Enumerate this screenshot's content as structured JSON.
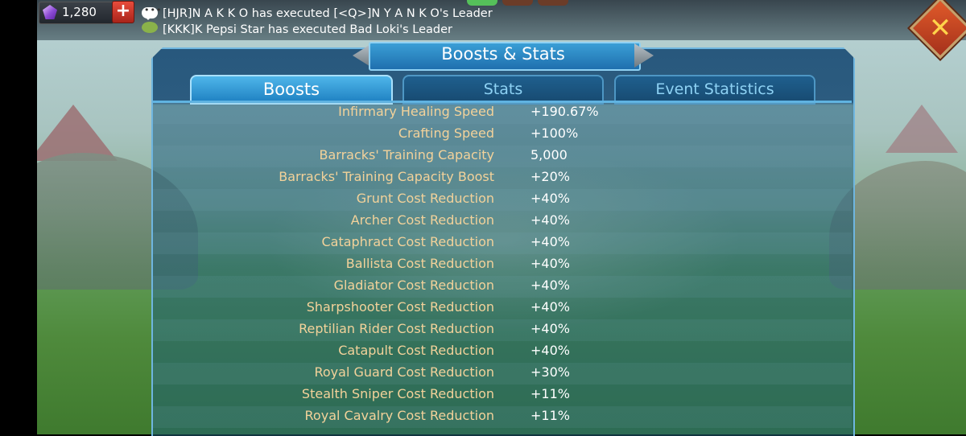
{
  "currency": {
    "gems": "1,280",
    "add_symbol": "+"
  },
  "chat": [
    "[HJR]N A K K O has executed [<Q>]N Y A N K O's Leader",
    "[KKK]K Pepsi Star has executed Bad Loki's Leader"
  ],
  "window": {
    "title": "Boosts & Stats",
    "close_symbol": "✕"
  },
  "tabs": [
    {
      "label": "Boosts",
      "active": true
    },
    {
      "label": "Stats",
      "active": false
    },
    {
      "label": "Event Statistics",
      "active": false
    }
  ],
  "boosts": [
    {
      "name": "Infirmary Healing Speed",
      "value": "+190.67%"
    },
    {
      "name": "Crafting Speed",
      "value": "+100%"
    },
    {
      "name": "Barracks' Training Capacity",
      "value": "5,000"
    },
    {
      "name": "Barracks' Training Capacity Boost",
      "value": "+20%"
    },
    {
      "name": "Grunt Cost Reduction",
      "value": "+40%"
    },
    {
      "name": "Archer Cost Reduction",
      "value": "+40%"
    },
    {
      "name": "Cataphract Cost Reduction",
      "value": "+40%"
    },
    {
      "name": "Ballista Cost Reduction",
      "value": "+40%"
    },
    {
      "name": "Gladiator Cost Reduction",
      "value": "+40%"
    },
    {
      "name": "Sharpshooter Cost Reduction",
      "value": "+40%"
    },
    {
      "name": "Reptilian Rider Cost Reduction",
      "value": "+40%"
    },
    {
      "name": "Catapult Cost Reduction",
      "value": "+40%"
    },
    {
      "name": "Royal Guard Cost Reduction",
      "value": "+30%"
    },
    {
      "name": "Stealth Sniper Cost Reduction",
      "value": "+11%"
    },
    {
      "name": "Royal Cavalry Cost Reduction",
      "value": "+11%"
    }
  ]
}
